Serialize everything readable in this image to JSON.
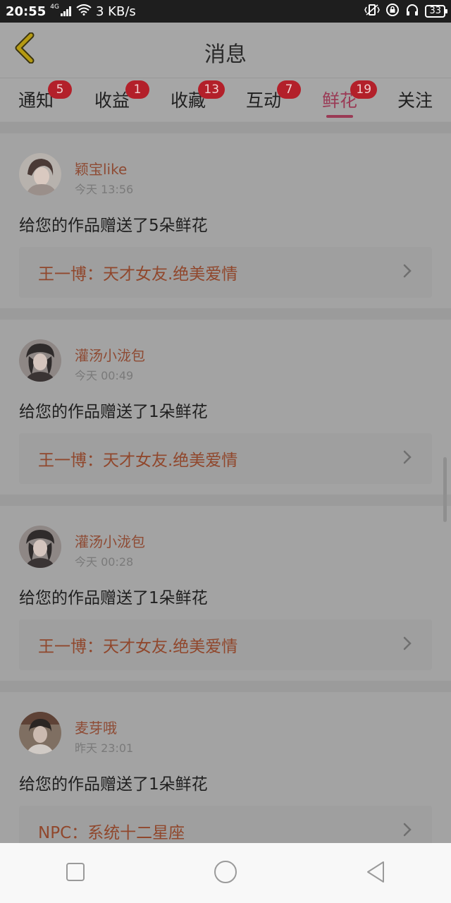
{
  "status_bar": {
    "time": "20:55",
    "network": "4G",
    "speed": "3 KB/s",
    "battery": "33"
  },
  "header": {
    "title": "消息"
  },
  "tabs": [
    {
      "label": "通知",
      "badge": "5"
    },
    {
      "label": "收益",
      "badge": "1"
    },
    {
      "label": "收藏",
      "badge": "13"
    },
    {
      "label": "互动",
      "badge": "7"
    },
    {
      "label": "鲜花",
      "badge": "19",
      "active": true
    },
    {
      "label": "关注",
      "badge": ""
    }
  ],
  "messages": [
    {
      "user": "颖宝like",
      "time": "今天 13:56",
      "text": "给您的作品赠送了5朵鲜花",
      "work": "王一博：天才女友.绝美爱情"
    },
    {
      "user": "灌汤小泷包",
      "time": "今天 00:49",
      "text": "给您的作品赠送了1朵鲜花",
      "work": "王一博：天才女友.绝美爱情"
    },
    {
      "user": "灌汤小泷包",
      "time": "今天 00:28",
      "text": "给您的作品赠送了1朵鲜花",
      "work": "王一博：天才女友.绝美爱情"
    },
    {
      "user": "麦芽哦",
      "time": "昨天 23:01",
      "text": "给您的作品赠送了1朵鲜花",
      "work": "NPC：系统十二星座"
    }
  ],
  "icons": {
    "back": "chevron-left-icon",
    "chevron": "chevron-right-icon",
    "nav_recent": "square-icon",
    "nav_home": "circle-icon",
    "nav_back": "triangle-back-icon"
  },
  "colors": {
    "active_tab": "#9a3a55",
    "badge": "#b3202a",
    "username": "#8e4b34",
    "work_title": "#90472c",
    "back_arrow": "#b59a12"
  }
}
